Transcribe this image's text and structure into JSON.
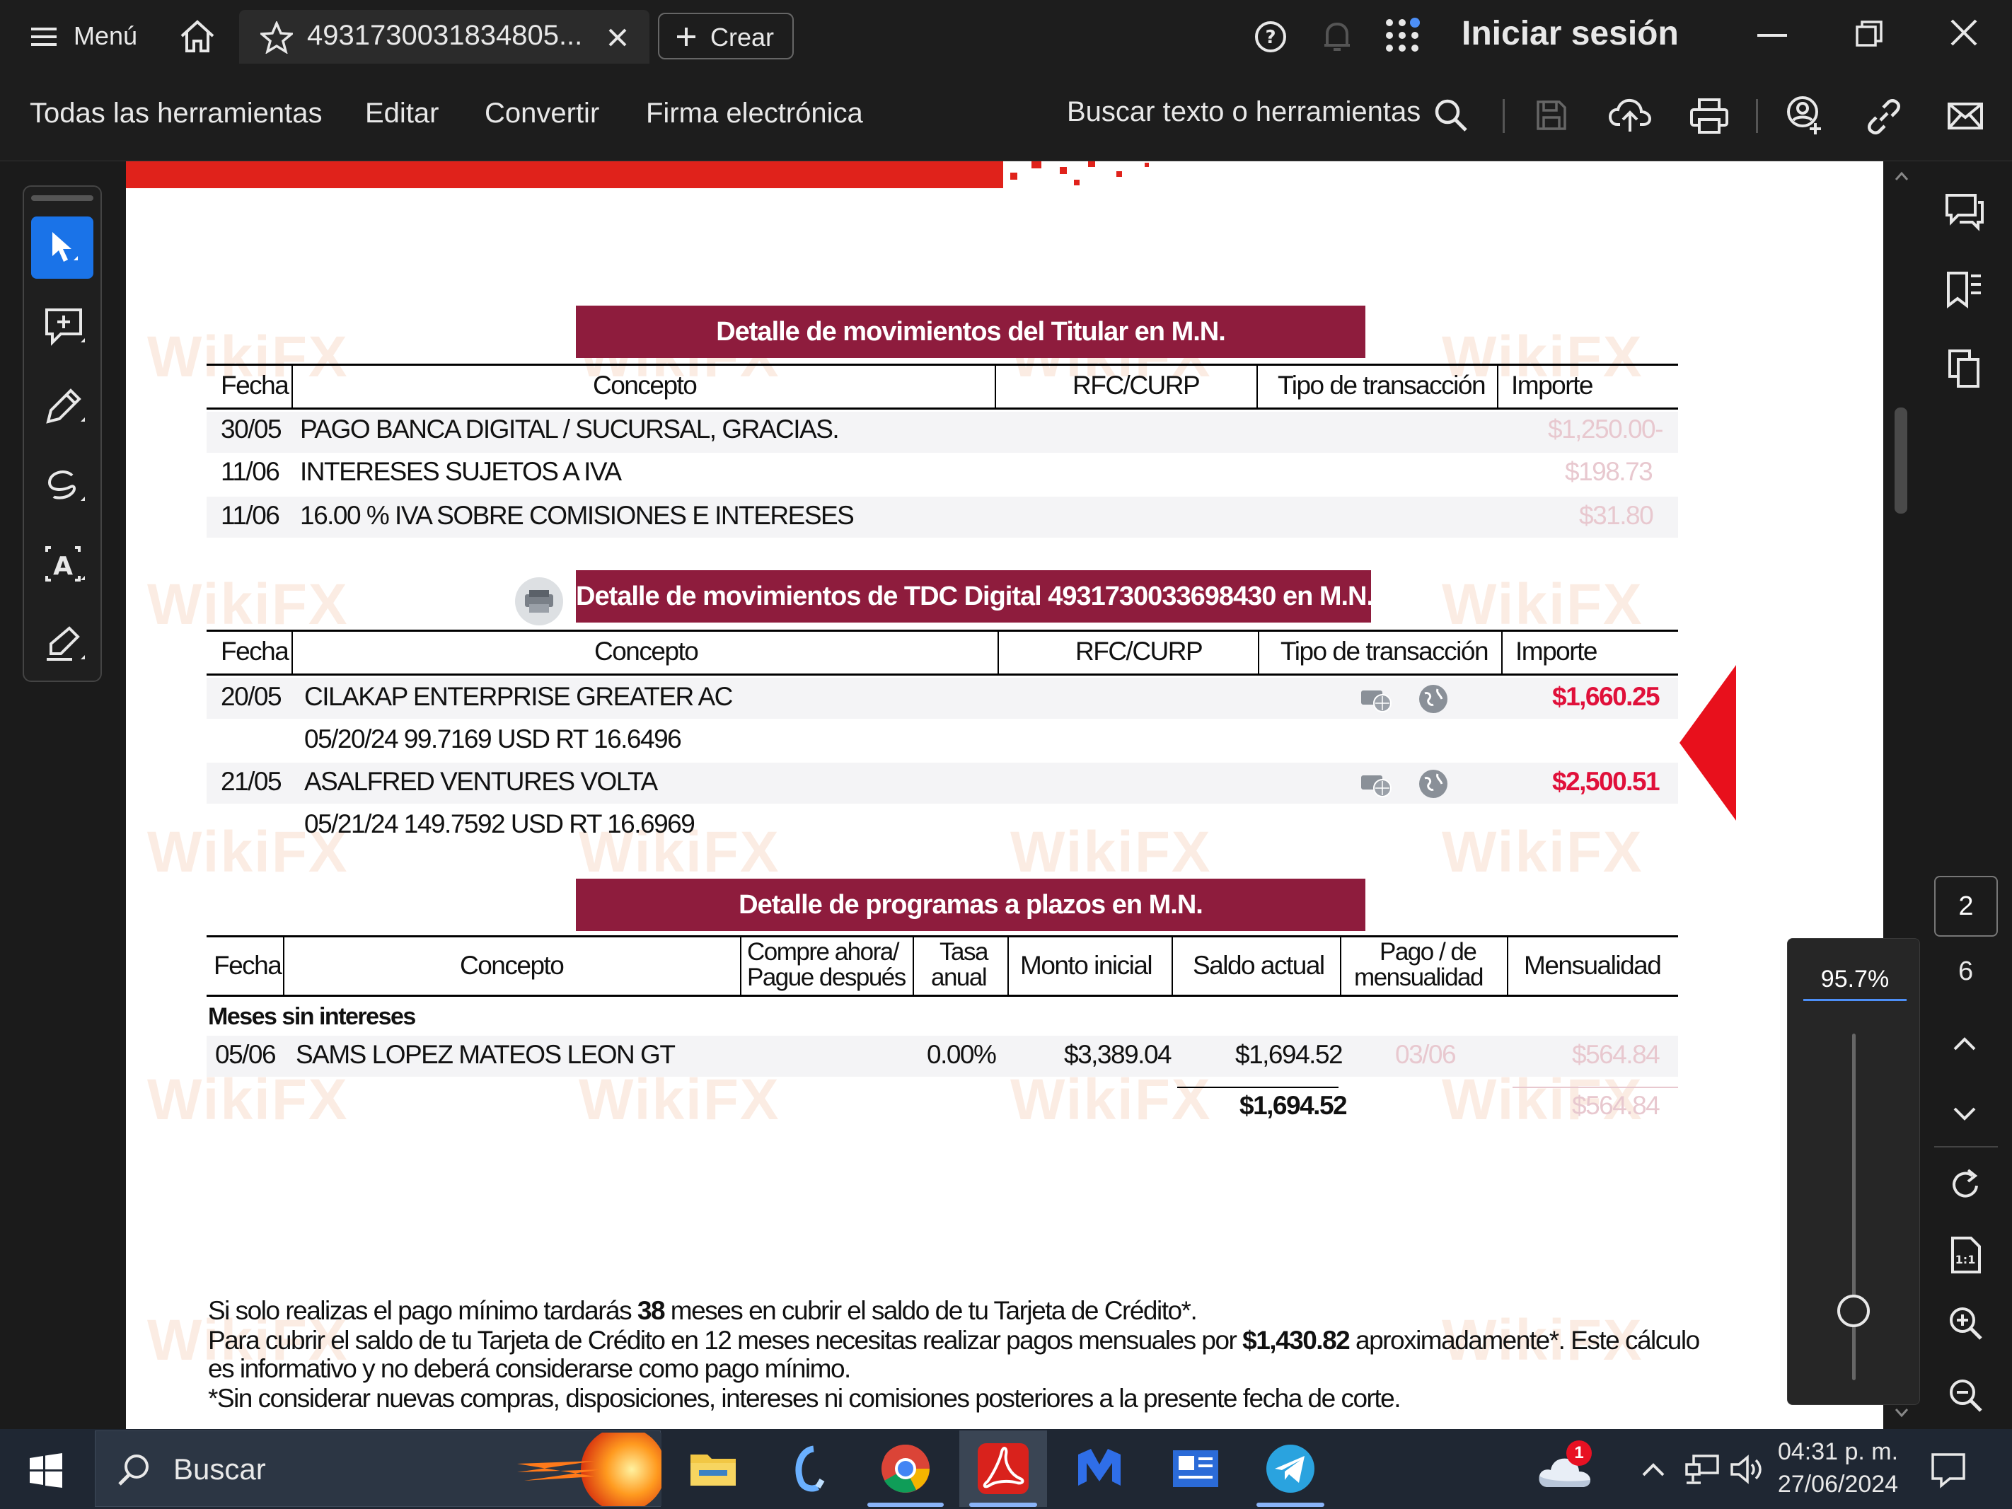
{
  "titlebar": {
    "menu_label": "Menú",
    "tab_title": "4931730031834805...",
    "create_label": "Crear",
    "signin_label": "Iniciar sesión"
  },
  "toolbar": {
    "all_tools": "Todas las herramientas",
    "edit": "Editar",
    "convert": "Convertir",
    "esign": "Firma electrónica",
    "search_placeholder": "Buscar texto o herramientas"
  },
  "document": {
    "section1": {
      "title": "Detalle de movimientos del Titular  en M.N.",
      "headers": [
        "Fecha",
        "Concepto",
        "RFC/CURP",
        "Tipo de transacción",
        "Importe"
      ],
      "rows": [
        {
          "date": "30/05",
          "concept": "PAGO BANCA DIGITAL / SUCURSAL, GRACIAS.",
          "amount": "$1,250.00-"
        },
        {
          "date": "11/06",
          "concept": "INTERESES SUJETOS A IVA",
          "amount": "$198.73"
        },
        {
          "date": "11/06",
          "concept": "16.00 % IVA SOBRE COMISIONES E INTERESES",
          "amount": "$31.80"
        }
      ]
    },
    "section2": {
      "title": "Detalle de movimientos de TDC Digital 4931730033698430 en M.N.",
      "headers": [
        "Fecha",
        "Concepto",
        "RFC/CURP",
        "Tipo de transacción",
        "Importe"
      ],
      "rows": [
        {
          "date": "20/05",
          "concept": "CILAKAP ENTERPRISE GREATER AC",
          "detail": "05/20/24 99.7169 USD RT 16.6496",
          "amount": "$1,660.25"
        },
        {
          "date": "21/05",
          "concept": "ASALFRED VENTURES VOLTA",
          "detail": "05/21/24 149.7592 USD RT 16.6969",
          "amount": "$2,500.51"
        }
      ]
    },
    "section3": {
      "title": "Detalle de programas a plazos en M.N.",
      "headers": {
        "date": "Fecha",
        "concept": "Concepto",
        "buy_now_1": "Compre ahora/",
        "buy_now_2": "Pague después",
        "rate_1": "Tasa",
        "rate_2": "anual",
        "initial": "Monto inicial",
        "balance": "Saldo actual",
        "payment_1": "Pago / de",
        "payment_2": "mensualidad",
        "monthly": "Mensualidad"
      },
      "group_label": "Meses sin intereses",
      "row": {
        "date": "05/06",
        "concept": "SAMS LOPEZ MATEOS LEON GT",
        "rate": "0.00%",
        "initial": "$3,389.04",
        "balance": "$1,694.52",
        "payment": "03/06",
        "monthly": "$564.84"
      },
      "total_balance": "$1,694.52",
      "total_monthly": "$564.84"
    },
    "footer": {
      "line1_a": "Si solo realizas el pago mínimo tardarás ",
      "line1_b": "38",
      "line1_c": " meses en cubrir el saldo de tu Tarjeta de Crédito*.",
      "line2_a": "Para cubrir el saldo de tu Tarjeta de Crédito en 12 meses necesitas realizar pagos mensuales por ",
      "line2_b": "$1,430.82",
      "line2_c": " aproximadamente*. Este cálculo",
      "line3": "es informativo y no deberá considerarse como pago mínimo.",
      "line4": "*Sin considerar nuevas compras, disposiciones, intereses ni comisiones posteriores a la presente fecha de corte."
    },
    "watermark": "WikiFX"
  },
  "rightrail": {
    "page_current": "2",
    "page_total": "6"
  },
  "zoom": {
    "value": "95.7%",
    "slider_fraction": 0.2
  },
  "taskbar": {
    "search_label": "Buscar",
    "time": "04:31 p. m.",
    "date": "27/06/2024",
    "notification_count": "1"
  },
  "colors": {
    "header_bar": "#8e1c3d",
    "amount_red": "#e0103a",
    "accent_blue": "#1a73e8"
  }
}
